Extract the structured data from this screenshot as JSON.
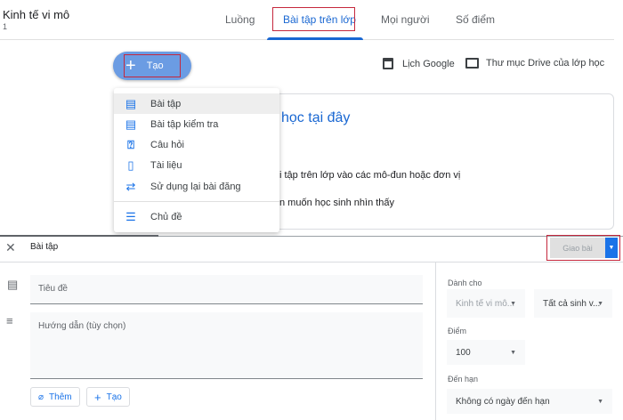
{
  "class": {
    "name": "Kinh tế vi mô",
    "section": "1"
  },
  "tabs": [
    {
      "label": "Luồng"
    },
    {
      "label": "Bài tập trên lớp",
      "active": true
    },
    {
      "label": "Mọi người"
    },
    {
      "label": "Số điểm"
    }
  ],
  "toolbar": {
    "create_label": "Tạo",
    "calendar_label": "Lịch Google",
    "drive_label": "Thư mục Drive của lớp học"
  },
  "create_menu": [
    {
      "label": "Bài tập",
      "icon": "assignment-icon"
    },
    {
      "label": "Bài tập kiểm tra",
      "icon": "quiz-assignment-icon"
    },
    {
      "label": "Câu hỏi",
      "icon": "question-icon"
    },
    {
      "label": "Tài liệu",
      "icon": "material-icon"
    },
    {
      "label": "Sử dụng lại bài đăng",
      "icon": "reuse-icon"
    },
    {
      "label": "Chủ đề",
      "icon": "topic-icon"
    }
  ],
  "card": {
    "title": "học tại đây",
    "line1": "i tập trên lớp vào các mô-đun hoặc đơn vị",
    "line2": "n muốn học sinh nhìn thấy"
  },
  "editor": {
    "title": "Bài tập",
    "assign_label": "Giao bài",
    "title_placeholder": "Tiêu đề",
    "instructions_placeholder": "Hướng dẫn (tùy chọn)",
    "add_label": "Thêm",
    "create_label": "Tạo",
    "for_label": "Dành cho",
    "class_value": "Kinh tế vi mô...",
    "students_value": "Tất cả sinh v...",
    "points_label": "Điểm",
    "points_value": "100",
    "due_label": "Đến hạn",
    "due_value": "Không có ngày đến hạn"
  },
  "colors": {
    "accent": "#1a73e8",
    "create_button": "#6b9ce3",
    "highlight_box": "#c5283d"
  }
}
